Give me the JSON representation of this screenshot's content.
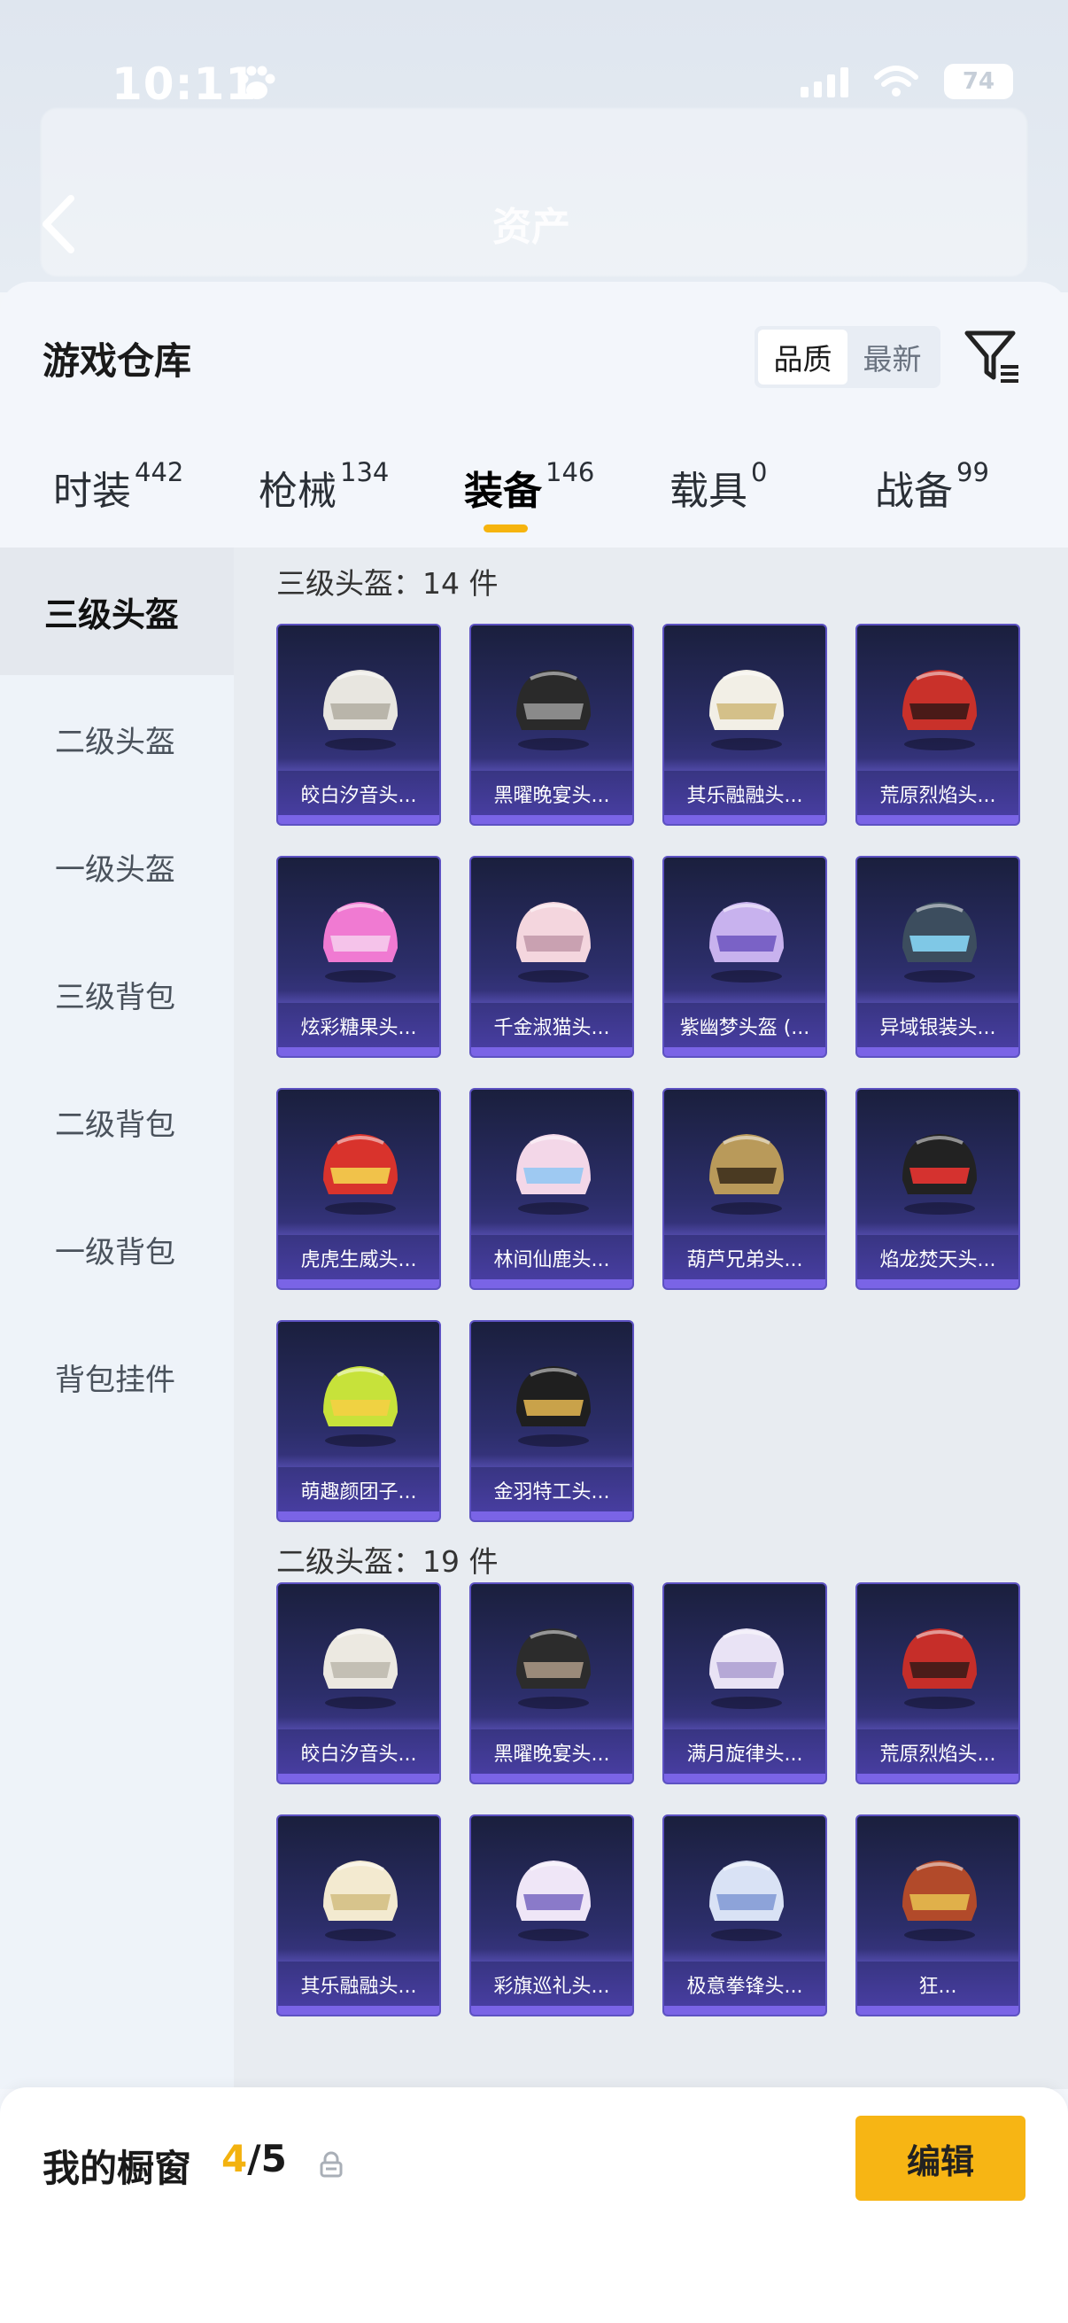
{
  "status": {
    "time": "10:11",
    "battery": "74"
  },
  "header": {
    "title": "资产"
  },
  "warehouse": {
    "title": "游戏仓库",
    "sort_options": [
      "品质",
      "最新"
    ],
    "tabs": [
      {
        "label": "时装",
        "count": "442"
      },
      {
        "label": "枪械",
        "count": "134"
      },
      {
        "label": "装备",
        "count": "146"
      },
      {
        "label": "载具",
        "count": "0"
      },
      {
        "label": "战备",
        "count": "99"
      }
    ],
    "sidebar": [
      "三级头盔",
      "二级头盔",
      "一级头盔",
      "三级背包",
      "二级背包",
      "一级背包",
      "背包挂件"
    ],
    "sections": [
      {
        "title": "三级头盔：14 件",
        "items": [
          "皎白汐音头...",
          "黑曜晚宴头...",
          "其乐融融头...",
          "荒原烈焰头...",
          "炫彩糖果头...",
          "千金淑猫头...",
          "紫幽梦头盔 (...",
          "异域银装头...",
          "虎虎生威头...",
          "林间仙鹿头...",
          "葫芦兄弟头...",
          "焰龙焚天头...",
          "萌趣颜团子...",
          "金羽特工头..."
        ]
      },
      {
        "title": "二级头盔：19 件",
        "items": [
          "皎白汐音头...",
          "黑曜晚宴头...",
          "满月旋律头...",
          "荒原烈焰头...",
          "其乐融融头...",
          "彩旗巡礼头...",
          "极意拳锋头...",
          "狂..."
        ]
      }
    ]
  },
  "showcase": {
    "label": "我的橱窗",
    "current": "4",
    "total": "/5",
    "edit_label": "编辑"
  },
  "colors": {
    "accent": "#f7b514",
    "card_bg_top": "#1a1f3d",
    "card_bg_bottom": "#4a3fa6"
  },
  "helmet_colors": [
    [
      "#e8e6e0",
      "#b9b5aa"
    ],
    [
      "#2a2a2a",
      "#8a8a8a"
    ],
    [
      "#f2efe6",
      "#d4c089"
    ],
    [
      "#c9312a",
      "#4a1a18"
    ],
    [
      "#f07ad2",
      "#f5c3ea"
    ],
    [
      "#f4d6de",
      "#c9a1b1"
    ],
    [
      "#c8b2ee",
      "#7a62c6"
    ],
    [
      "#3c4d5e",
      "#7fc8e6"
    ],
    [
      "#d9332c",
      "#f1c24a"
    ],
    [
      "#f3d7e8",
      "#9ec9f2"
    ],
    [
      "#b99a5a",
      "#4a3a22"
    ],
    [
      "#222",
      "#d5322f"
    ],
    [
      "#c7e23a",
      "#f0d242"
    ],
    [
      "#1f1f1f",
      "#c9a24a"
    ],
    [
      "#ece9e1",
      "#c3bfb4"
    ],
    [
      "#2c2c2c",
      "#9a8a7a"
    ],
    [
      "#e9e3f5",
      "#b5a8d6"
    ],
    [
      "#c62e29",
      "#4b1c19"
    ],
    [
      "#f3ead0",
      "#d7c48c"
    ],
    [
      "#efe6f7",
      "#8a7ac9"
    ],
    [
      "#d9e2f5",
      "#8da3d9"
    ],
    [
      "#b24a2a",
      "#e0b04a"
    ]
  ]
}
